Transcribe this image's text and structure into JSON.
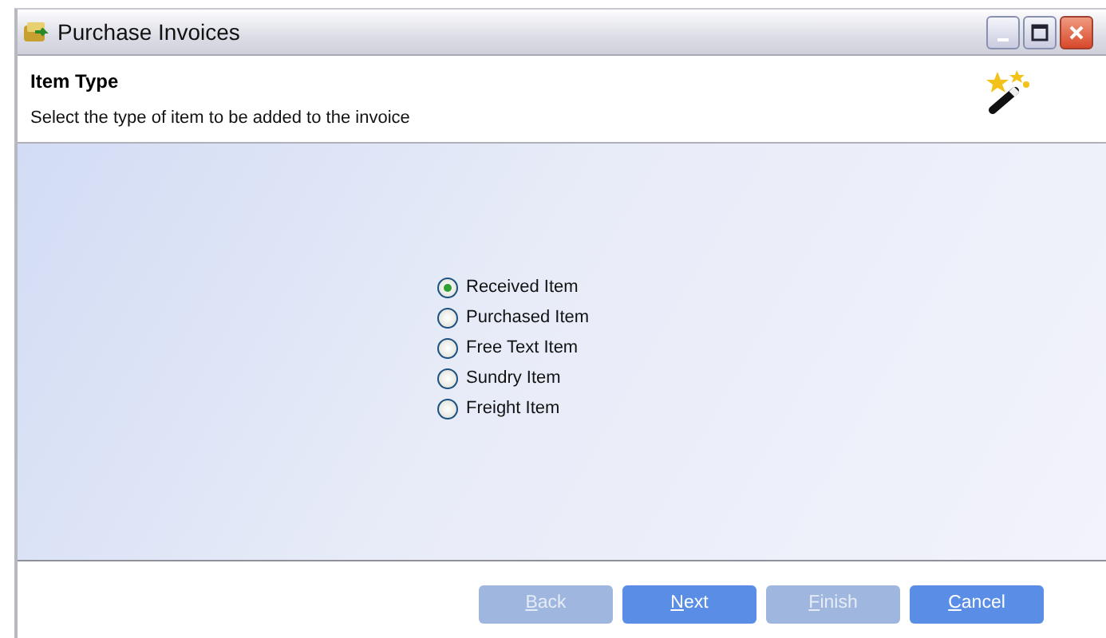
{
  "window": {
    "title": "Purchase Invoices"
  },
  "header": {
    "title": "Item Type",
    "subtitle": "Select the type of item to be added to the invoice"
  },
  "options": [
    {
      "label": "Received Item",
      "selected": true
    },
    {
      "label": "Purchased Item",
      "selected": false
    },
    {
      "label": "Free Text Item",
      "selected": false
    },
    {
      "label": "Sundry Item",
      "selected": false
    },
    {
      "label": "Freight Item",
      "selected": false
    }
  ],
  "buttons": [
    {
      "label": "Back",
      "disabled": true
    },
    {
      "label": "Next",
      "disabled": false
    },
    {
      "label": "Finish",
      "disabled": true
    },
    {
      "label": "Cancel",
      "disabled": false
    }
  ]
}
